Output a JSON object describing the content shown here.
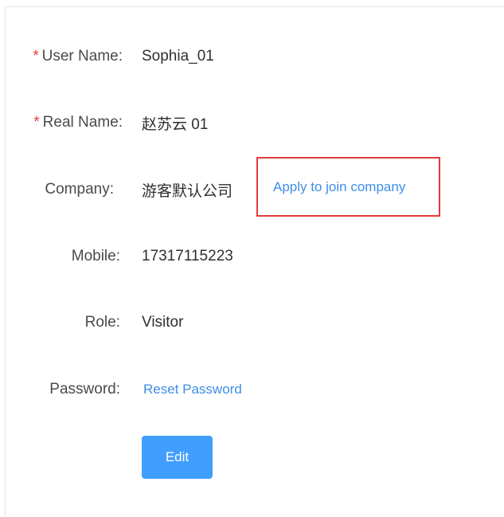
{
  "required_mark": "*",
  "fields": {
    "username": {
      "label": "User Name:",
      "value": "Sophia_01",
      "required": true
    },
    "realname": {
      "label": "Real Name:",
      "value": "赵苏云 01",
      "required": true
    },
    "company": {
      "label": "Company:",
      "value": "游客默认公司",
      "required": false,
      "action": "Apply to join company"
    },
    "mobile": {
      "label": "Mobile:",
      "value": "17317115223",
      "required": false
    },
    "role": {
      "label": "Role:",
      "value": "Visitor",
      "required": false
    },
    "password": {
      "label": "Password:",
      "action": "Reset Password",
      "required": false
    }
  },
  "edit_button": "Edit",
  "colors": {
    "required": "#e8413b",
    "link": "#3d8ee6",
    "primary_button": "#409eff",
    "highlight_box": "#e33b3b"
  }
}
